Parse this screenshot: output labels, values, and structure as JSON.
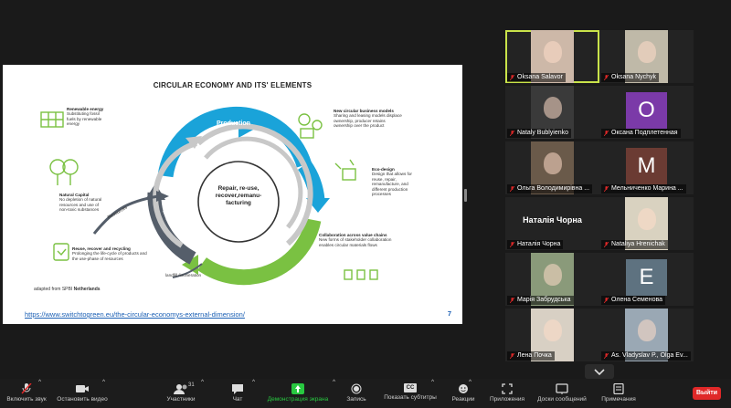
{
  "slide": {
    "title": "CIRCULAR ECONOMY AND ITS' ELEMENTS",
    "center_text": [
      "Repair, re-use,",
      "recover,remanu-",
      "facturing"
    ],
    "arc_labels": {
      "production": "Production",
      "use": "Use",
      "recycling": "Recycling",
      "resources": "Resources"
    },
    "landfill": "landfill /incineration",
    "elements": {
      "renewable": {
        "title": "Renewable energy",
        "text": [
          "Substituting fossil",
          "fuels by renewable",
          "energy"
        ]
      },
      "natural": {
        "title": "Natural Capital",
        "text": [
          "No depletion of natural",
          "resources and use of",
          "non-toxic substances"
        ]
      },
      "reuse": {
        "title": "Reuse, recover and recycling",
        "text": [
          "Prolonging the life-cycle of products and",
          "the use-phase of resources"
        ]
      },
      "business": {
        "title": "New circular business models",
        "text": [
          "Sharing and leasing models displace",
          "ownership, producer retains",
          "ownership over the product"
        ]
      },
      "ecodesign": {
        "title": "Eco-design",
        "text": [
          "Design that allows for",
          "reuse, repair,",
          "remanufacture, and",
          "different production",
          "processes"
        ]
      },
      "collab": {
        "title": "Collaboration across value chains",
        "text": [
          "New forms of stakeholder collaboration",
          "enables circular materials flows"
        ]
      }
    },
    "source_prefix": "adapted from SPBI",
    "source_bold": "Netherlands",
    "link": "https://www.switchtogreen.eu/the-circular-economys-external-dimension/",
    "page_number": "7"
  },
  "participants": [
    {
      "name": "Oksana Salavor",
      "kind": "video",
      "active": true
    },
    {
      "name": "Oksana Nychyk",
      "kind": "video"
    },
    {
      "name": "Nataly Bublyienko",
      "kind": "video"
    },
    {
      "name": "Оксана Подплетенная",
      "kind": "initial",
      "initial": "O",
      "color": "#7b3aa8"
    },
    {
      "name": "Ольга Володимирівна ...",
      "kind": "video"
    },
    {
      "name": "Мельниченко Марина ...",
      "kind": "initial",
      "initial": "M",
      "color": "#6b3b33"
    },
    {
      "name": "Наталія Чорна",
      "kind": "nameonly",
      "display": "Наталія Чорна"
    },
    {
      "name": "Nataliya Hrenichak",
      "kind": "video"
    },
    {
      "name": "Марія Забрудська",
      "kind": "video"
    },
    {
      "name": "Олена Семенова",
      "kind": "initial",
      "initial": "E",
      "color": "#5e7280"
    },
    {
      "name": "Лена Почка",
      "kind": "video"
    },
    {
      "name": "As. Vladyslav P., Olga Ev...",
      "kind": "video"
    }
  ],
  "toolbar": {
    "mute": "Включить звук",
    "video": "Остановить видео",
    "participants": "Участники",
    "participants_count": "31",
    "chat": "Чат",
    "share": "Демонстрация экрана",
    "record": "Запись",
    "captions": "Показать субтитры",
    "reactions": "Реакции",
    "apps": "Приложения",
    "board": "Доски сообщений",
    "notes": "Примечания",
    "leave": "Выйти",
    "cc": "CC"
  },
  "colors": {
    "accent_green": "#28c840",
    "leave_red": "#e02828",
    "active_border": "#c9e34a",
    "cycle_blue": "#1aa3d9",
    "cycle_green": "#7ac142",
    "cycle_gray": "#555e6a"
  }
}
